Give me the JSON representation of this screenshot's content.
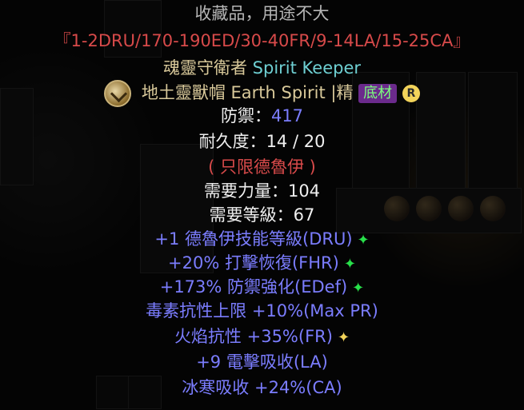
{
  "item": {
    "header": "收藏品，用途不大",
    "code": "『1-2DRU/170-190ED/30-40FR/9-14LA/15-25CA』",
    "unique_name_cn": "魂靈守衛者",
    "unique_name_en": "Spirit Keeper",
    "base_name_cn": "地土靈獸帽",
    "base_name_en": "Earth Spirit",
    "quality_label": "|精",
    "badge_base": "底材",
    "badge_r": "R",
    "defense_label": "防禦：",
    "defense_value": "417",
    "durability_label": "耐久度：",
    "durability_value": "14 / 20",
    "class_restriction": "( 只限德魯伊 )",
    "str_req_label": "需要力量：",
    "str_req_value": "104",
    "lvl_req_label": "需要等級：",
    "lvl_req_value": "67",
    "mods": [
      {
        "text": "+1 德魯伊技能等級(DRU)",
        "bullet": "✦",
        "bullet_color": "green"
      },
      {
        "text": "+20% 打擊恢復(FHR)",
        "bullet": "✦",
        "bullet_color": "green"
      },
      {
        "text": "+173% 防禦強化(EDef)",
        "bullet": "✦",
        "bullet_color": "green"
      },
      {
        "text": "毒素抗性上限 +10%(Max PR)",
        "bullet": "",
        "bullet_color": ""
      },
      {
        "text": "火焰抗性 +35%(FR)",
        "bullet": "✦",
        "bullet_color": "yellow"
      },
      {
        "text": "+9 電擊吸收(LA)",
        "bullet": "",
        "bullet_color": ""
      },
      {
        "text": "冰寒吸收 +24%(CA)",
        "bullet": "",
        "bullet_color": ""
      }
    ]
  },
  "colors": {
    "header": "#b6b6b6",
    "code": "#d84a4a",
    "unique_name": "#d9c99a",
    "english_name": "#6ecfd2",
    "stat_white": "#efefef",
    "stat_blue": "#7b7dff",
    "restriction_red": "#d84a4a",
    "bullet_green": "#28e04a",
    "bullet_yellow": "#f2d35a"
  }
}
